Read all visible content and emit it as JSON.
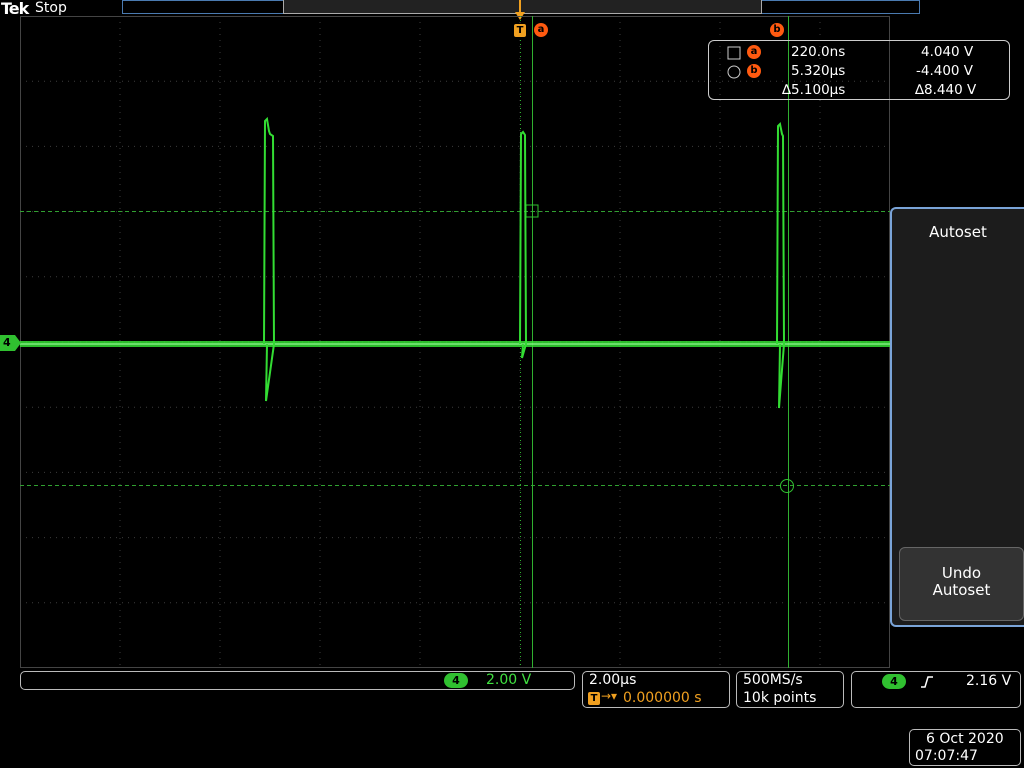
{
  "brand": {
    "name": "Tek",
    "state": "Stop"
  },
  "trigger_marker": {
    "label": "T"
  },
  "cursor_a_label": "a",
  "cursor_b_label": "b",
  "readout": {
    "a": {
      "time": "220.0ns",
      "volts": "4.040 V"
    },
    "b": {
      "time": "5.320µs",
      "volts": "-4.400 V"
    },
    "delta": {
      "time": "∆5.100µs",
      "volts": "∆8.440 V"
    }
  },
  "channel": {
    "number": "4",
    "scale": "2.00 V",
    "color": "#33dd33"
  },
  "timebase": {
    "per_div": "2.00µs",
    "trigger_badge": "T",
    "arrow": "→▾",
    "position": "0.000000 s"
  },
  "acquisition": {
    "rate": "500MS/s",
    "record": "10k points"
  },
  "trigger": {
    "source": "4",
    "slope_icon": "rising-edge",
    "level": "2.16 V"
  },
  "datetime": {
    "date": "6 Oct  2020",
    "time": "07:07:47"
  },
  "side_menu": {
    "title": "Autoset",
    "undo_line1": "Undo",
    "undo_line2": "Autoset"
  },
  "colors": {
    "trace": "#33dd33",
    "grid": "#3a3a3a",
    "cursor": "#30b030",
    "trigger": "#f0a020",
    "accent": "#ff5a10"
  }
}
